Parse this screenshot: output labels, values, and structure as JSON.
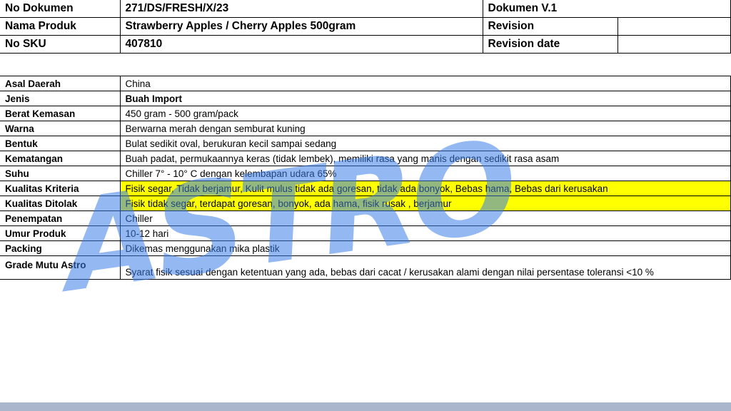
{
  "header": {
    "rows": [
      [
        "No Dokumen",
        "271/DS/FRESH/X/23",
        "Dokumen V.1",
        ""
      ],
      [
        "Nama Produk",
        "Strawberry Apples / Cherry Apples 500gram",
        "Revision",
        ""
      ],
      [
        "No SKU",
        "407810",
        "Revision date",
        ""
      ]
    ]
  },
  "spec": {
    "rows": [
      {
        "label": "Asal Daerah",
        "value": "China"
      },
      {
        "label": "Jenis",
        "value": "Buah Import"
      },
      {
        "label": "Berat Kemasan",
        "value": "450 gram - 500 gram/pack"
      },
      {
        "label": "Warna",
        "value": "Berwarna merah dengan semburat kuning"
      },
      {
        "label": "Bentuk",
        "value": "Bulat sedikit oval, berukuran kecil sampai sedang"
      },
      {
        "label": "Kematangan",
        "value": "Buah padat, permukaannya keras (tidak lembek), memiliki rasa yang manis dengan sedikit rasa asam"
      },
      {
        "label": "Suhu",
        "value": "Chiller 7° - 10° C dengan kelembapan udara 65%"
      },
      {
        "label": "Kualitas Kriteria",
        "value": "Fisik segar, Tidak berjamur, Kulit mulus tidak ada goresan, tidak ada bonyok, Bebas hama, Bebas dari kerusakan"
      },
      {
        "label": "Kualitas Ditolak",
        "value": "Fisik tidak segar, terdapat goresan, bonyok, ada hama, fisik rusak , berjamur"
      },
      {
        "label": "Penempatan",
        "value": "Chiller"
      },
      {
        "label": "Umur Produk",
        "value": "10-12 hari"
      },
      {
        "label": "Packing",
        "value": "Dikemas menggunakan mika plastik"
      },
      {
        "label": "Grade Mutu Astro",
        "value": "Syarat fisik sesuai dengan ketentuan yang ada, bebas dari cacat / kerusakan alami dengan  nilai persentase toleransi <10 %"
      }
    ]
  },
  "watermark": {
    "text": "ASTRO",
    "color": "#3a7ee8"
  },
  "colors": {
    "highlight": "#ffff00",
    "footer": "#a9b6cc"
  }
}
